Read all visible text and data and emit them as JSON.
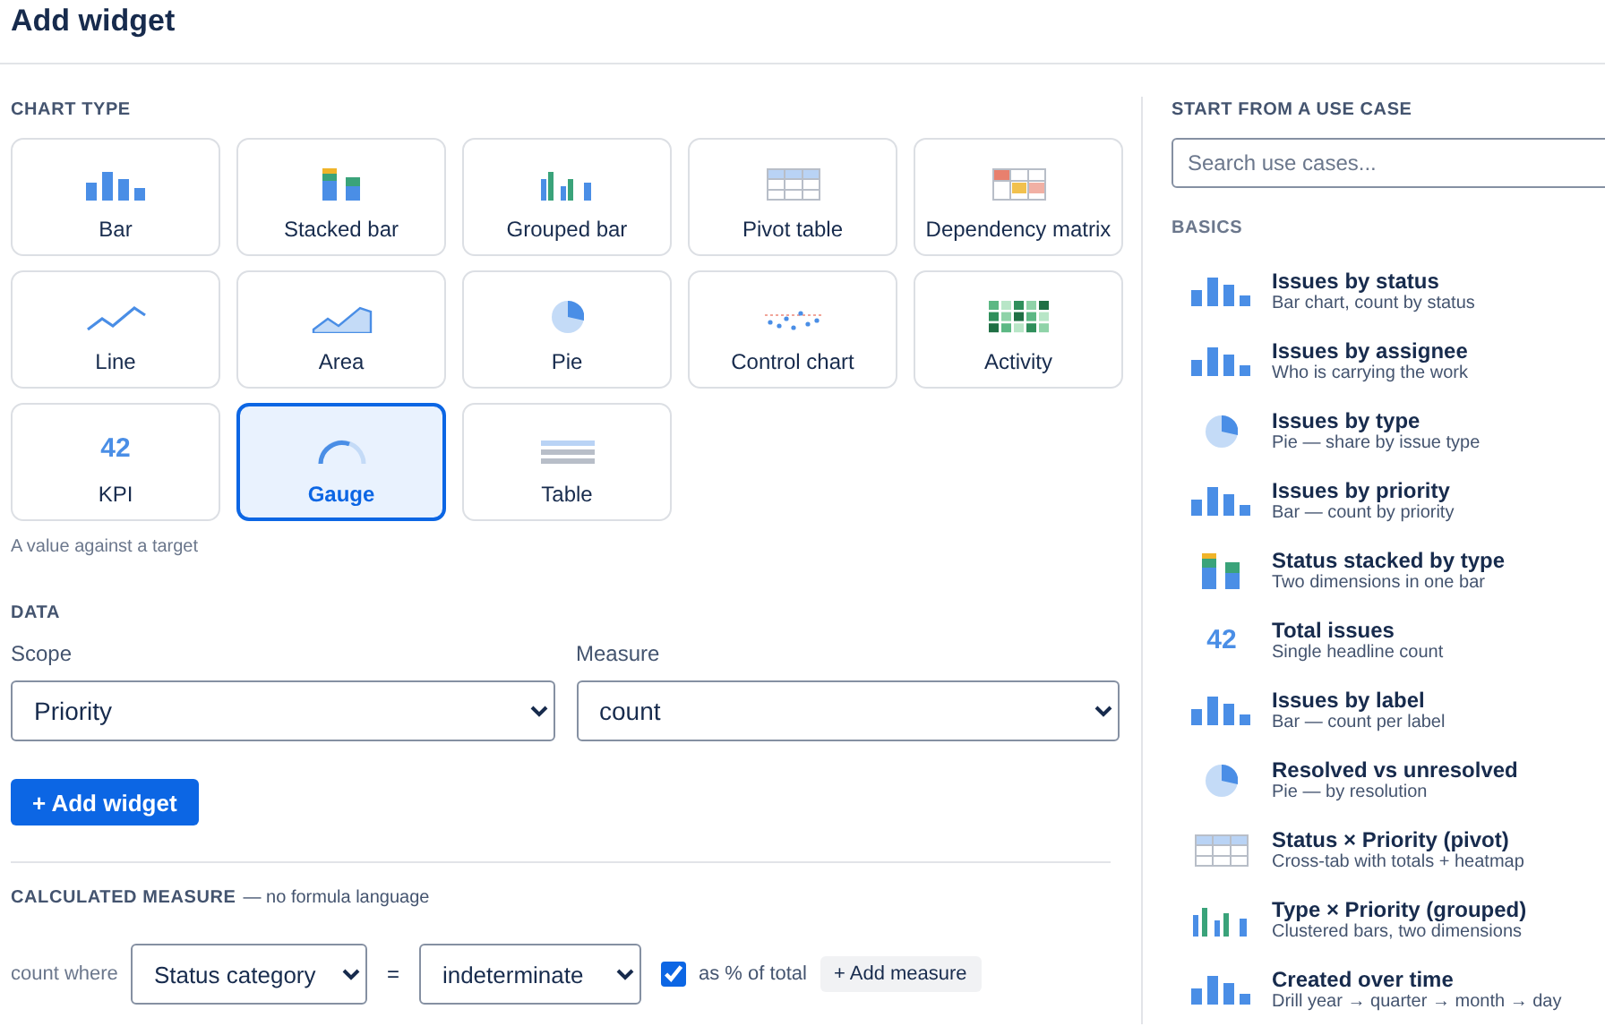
{
  "title": "Add widget",
  "chart_type": {
    "heading": "CHART TYPE",
    "hint": "A value against a target",
    "types": [
      {
        "label": "Bar",
        "kind": "bar",
        "selected": false
      },
      {
        "label": "Stacked bar",
        "kind": "stacked",
        "selected": false
      },
      {
        "label": "Grouped bar",
        "kind": "grouped",
        "selected": false
      },
      {
        "label": "Pivot table",
        "kind": "pivot",
        "selected": false
      },
      {
        "label": "Dependency matrix",
        "kind": "matrix",
        "selected": false
      },
      {
        "label": "Line",
        "kind": "line",
        "selected": false
      },
      {
        "label": "Area",
        "kind": "area",
        "selected": false
      },
      {
        "label": "Pie",
        "kind": "pie",
        "selected": false
      },
      {
        "label": "Control chart",
        "kind": "control",
        "selected": false
      },
      {
        "label": "Activity",
        "kind": "activity",
        "selected": false
      },
      {
        "label": "KPI",
        "kind": "kpi",
        "icon_text": "42",
        "selected": false
      },
      {
        "label": "Gauge",
        "kind": "gauge",
        "selected": true
      },
      {
        "label": "Table",
        "kind": "table",
        "selected": false
      }
    ]
  },
  "data": {
    "heading": "DATA",
    "scope": {
      "label": "Scope",
      "value": "Priority"
    },
    "measure": {
      "label": "Measure",
      "value": "count"
    },
    "add_button": "+ Add widget"
  },
  "calculated_measure": {
    "heading": "CALCULATED MEASURE",
    "note": "— no formula language",
    "prefix": "count where",
    "field": "Status category",
    "operator": "=",
    "value": "indeterminate",
    "percent": {
      "label": "as % of total",
      "checked": true
    },
    "add_button": "+ Add measure"
  },
  "use_cases": {
    "heading": "START FROM A USE CASE",
    "search": {
      "placeholder": "Search use cases..."
    },
    "group": "BASICS",
    "items": [
      {
        "title": "Issues by status",
        "subtitle": "Bar chart, count by status",
        "kind": "bar"
      },
      {
        "title": "Issues by assignee",
        "subtitle": "Who is carrying the work",
        "kind": "bar"
      },
      {
        "title": "Issues by type",
        "subtitle": "Pie — share by issue type",
        "kind": "pie"
      },
      {
        "title": "Issues by priority",
        "subtitle": "Bar — count by priority",
        "kind": "bar"
      },
      {
        "title": "Status stacked by type",
        "subtitle": "Two dimensions in one bar",
        "kind": "stacked"
      },
      {
        "title": "Total issues",
        "subtitle": "Single headline count",
        "kind": "kpi",
        "icon_text": "42"
      },
      {
        "title": "Issues by label",
        "subtitle": "Bar — count per label",
        "kind": "bar"
      },
      {
        "title": "Resolved vs unresolved",
        "subtitle": "Pie — by resolution",
        "kind": "pie"
      },
      {
        "title": "Status × Priority (pivot)",
        "subtitle": "Cross-tab with totals + heatmap",
        "kind": "pivot"
      },
      {
        "title": "Type × Priority (grouped)",
        "subtitle": "Clustered bars, two dimensions",
        "kind": "grouped"
      },
      {
        "title": "Created over time",
        "subtitle": "Drill year → quarter → month → day",
        "kind": "bar"
      }
    ]
  }
}
